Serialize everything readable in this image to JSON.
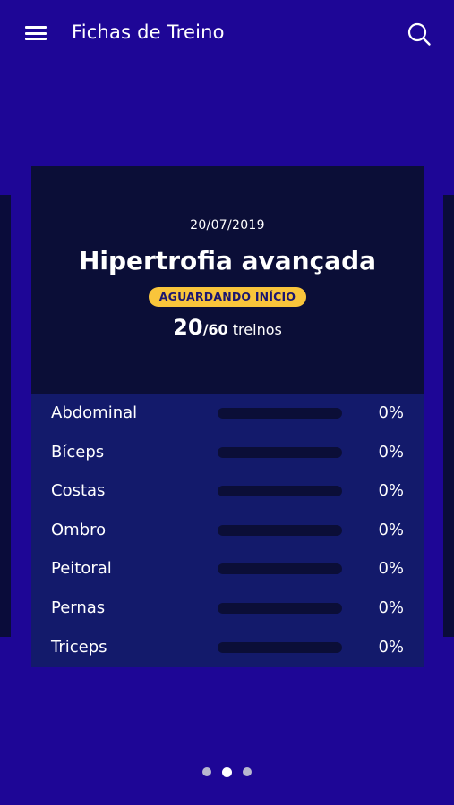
{
  "header": {
    "title": "Fichas de Treino",
    "menu_icon": "hamburger-menu-icon",
    "search_icon": "search-icon"
  },
  "card": {
    "date": "20/07/2019",
    "name": "Hipertrofia avançada",
    "status": "AGUARDANDO INÍCIO",
    "sessions_done": "20",
    "sessions_total": "/60",
    "sessions_unit": " treinos",
    "rows": [
      {
        "label": "Abdominal",
        "percent": "0%",
        "progress": 0
      },
      {
        "label": "Bíceps",
        "percent": "0%",
        "progress": 0
      },
      {
        "label": "Costas",
        "percent": "0%",
        "progress": 0
      },
      {
        "label": "Ombro",
        "percent": "0%",
        "progress": 0
      },
      {
        "label": "Peitoral",
        "percent": "0%",
        "progress": 0
      },
      {
        "label": "Pernas",
        "percent": "0%",
        "progress": 0
      },
      {
        "label": "Triceps",
        "percent": "0%",
        "progress": 0
      }
    ]
  },
  "pager": {
    "count": 3,
    "active_index": 1
  },
  "colors": {
    "background": "#1e0696",
    "card_dark": "#0b0e37",
    "card_body": "#131a6b",
    "badge": "#f9c53b",
    "badge_text": "#1b1670"
  }
}
